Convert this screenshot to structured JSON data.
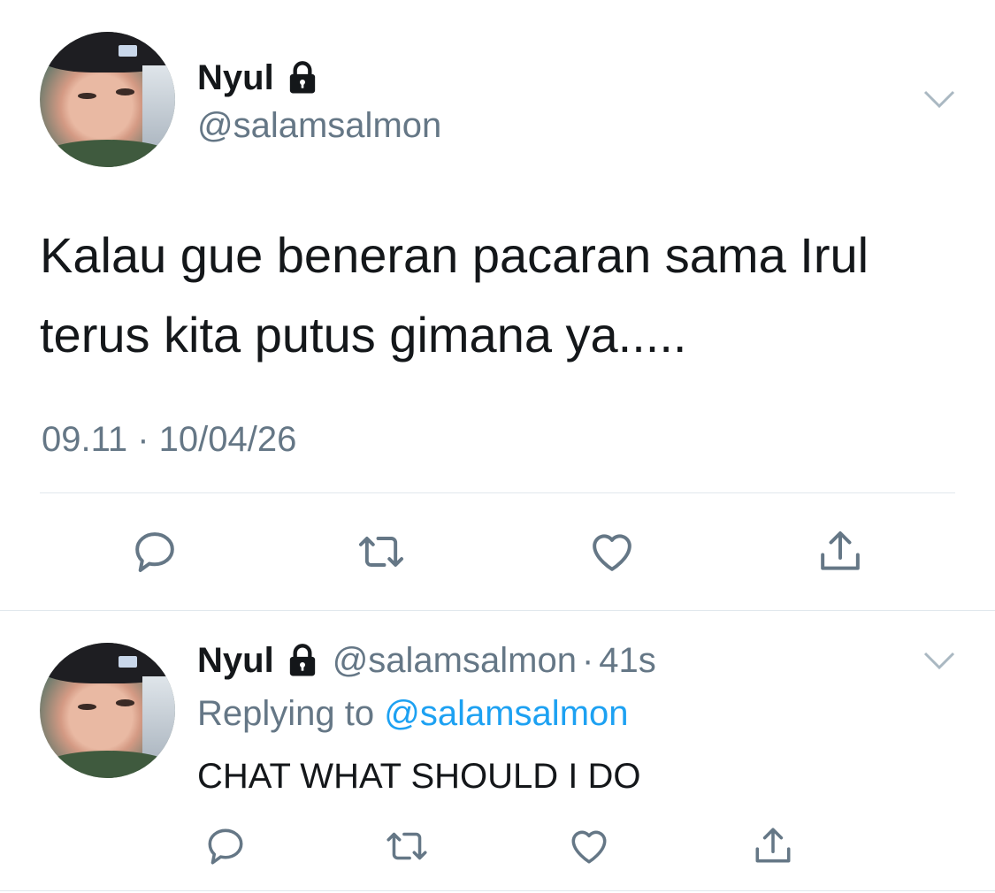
{
  "main_tweet": {
    "display_name": "Nyul",
    "handle": "@salamsalmon",
    "text_line1": "Kalau gue beneran pacaran sama Irul",
    "text_line2": "terus kita putus gimana ya.....",
    "timestamp": "09.11 · 10/04/26",
    "icons": [
      "reply-icon",
      "retweet-icon",
      "like-icon",
      "share-icon"
    ]
  },
  "reply_tweet": {
    "display_name": "Nyul",
    "handle": "@salamsalmon",
    "age": "41s",
    "replying_prefix": "Replying to",
    "replying_handle": "@salamsalmon",
    "text": "CHAT WHAT SHOULD I DO",
    "icons": [
      "reply-icon",
      "retweet-icon",
      "like-icon",
      "share-icon"
    ]
  },
  "colors": {
    "text": "#14171a",
    "muted": "#657786",
    "link": "#1da1f2",
    "divider": "#e1e8ed",
    "icon": "#657786"
  }
}
